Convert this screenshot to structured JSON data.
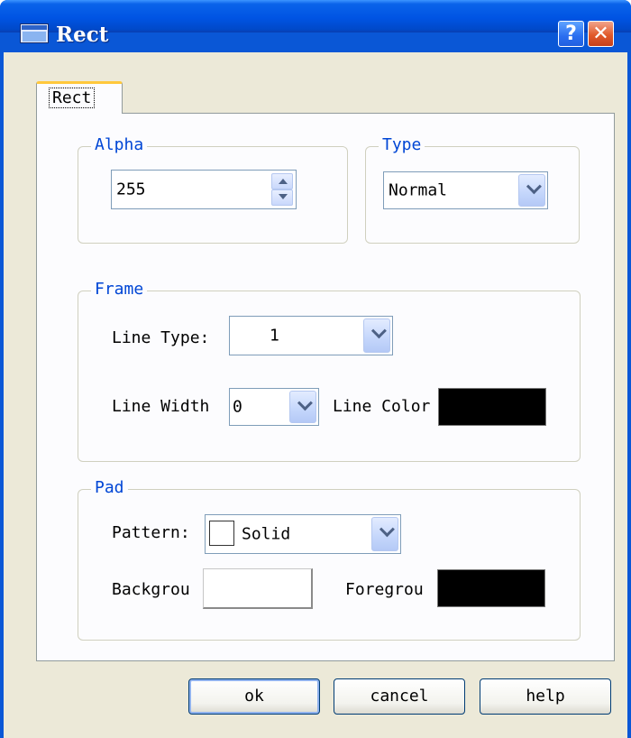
{
  "window": {
    "title": "Rect",
    "help_glyph": "?",
    "close_glyph": "✕",
    "icon": "app-window-icon"
  },
  "tab": {
    "label": "Rect"
  },
  "alpha": {
    "title": "Alpha",
    "value": "255"
  },
  "type": {
    "title": "Type",
    "value": "Normal"
  },
  "frame": {
    "title": "Frame",
    "line_type_label": "Line Type:",
    "line_type_value": "1",
    "line_width_label": "Line Width",
    "line_width_value": "0",
    "line_color_label": "Line Color",
    "line_color": "#000000"
  },
  "pad": {
    "title": "Pad",
    "pattern_label": "Pattern:",
    "pattern_value": "Solid",
    "background_label": "Backgrou",
    "background_color": "#ffffff",
    "foreground_label": "Foregrou",
    "foreground_color": "#000000"
  },
  "buttons": {
    "ok": "ok",
    "cancel": "cancel",
    "help": "help"
  }
}
